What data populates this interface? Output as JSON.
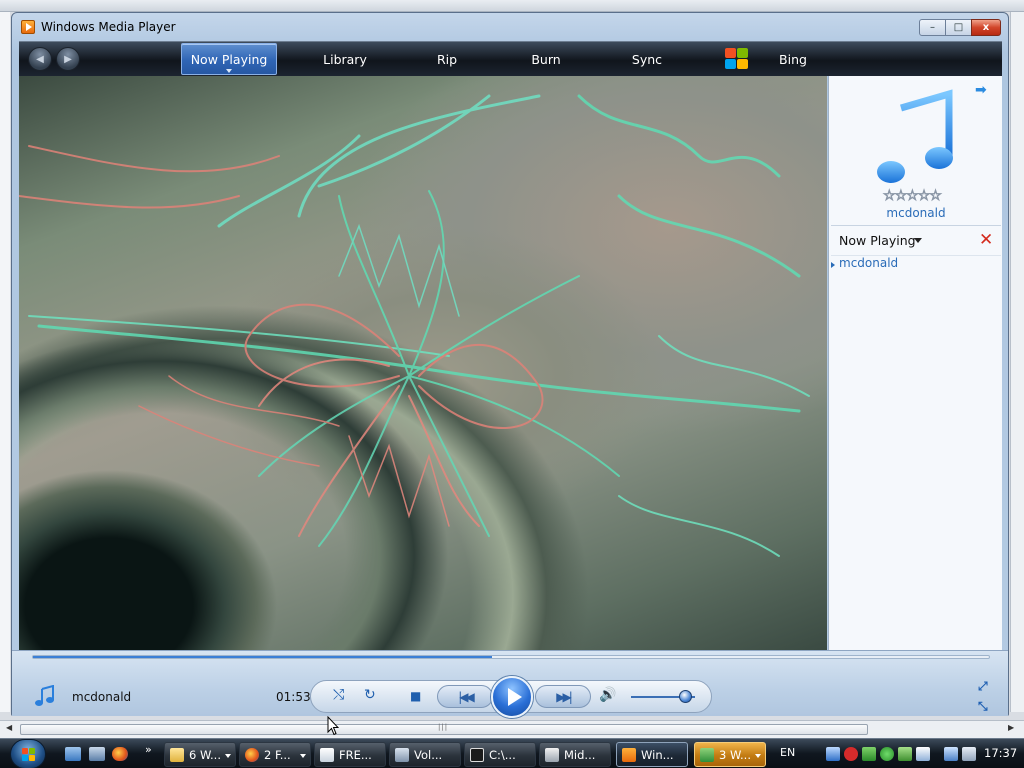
{
  "window": {
    "title": "Windows Media Player",
    "controls": {
      "minimize": "–",
      "maximize": "□",
      "close": "x"
    }
  },
  "nav": {
    "back_glyph": "◀",
    "forward_glyph": "▶",
    "tabs": [
      {
        "label": "Now Playing",
        "active": true
      },
      {
        "label": "Library"
      },
      {
        "label": "Rip"
      },
      {
        "label": "Burn"
      },
      {
        "label": "Sync"
      },
      {
        "label": "Bing"
      }
    ]
  },
  "panel": {
    "album_title": "mcdonald",
    "rating": {
      "filled": 0,
      "max": 5
    },
    "stars": [
      "☆",
      "☆",
      "☆",
      "☆",
      "☆"
    ],
    "arrow_glyph": "➡",
    "now_playing_label": "Now Playing",
    "clear_glyph": "✕",
    "playlist": [
      "mcdonald"
    ]
  },
  "player": {
    "song_title": "mcdonald",
    "elapsed": "01:53",
    "seek_progress": 0.48,
    "volume": 0.85,
    "shuffle_glyph": "⤭",
    "repeat_glyph": "↻",
    "stop_glyph": "■",
    "prev_glyph": "|◀◀",
    "next_glyph": "▶▶|",
    "volume_glyph": "🔊",
    "fullscreen_glyph": "⤢",
    "compact_glyph": "⤡"
  },
  "taskbar": {
    "quick_more": "»",
    "tasks": [
      {
        "label": "6 W...",
        "active": false,
        "grouped": true
      },
      {
        "label": "2 F...",
        "active": false,
        "grouped": true
      },
      {
        "label": "FRE...",
        "active": false
      },
      {
        "label": "Vol...",
        "active": false
      },
      {
        "label": "C:\\...",
        "active": false
      },
      {
        "label": "Mid...",
        "active": false
      },
      {
        "label": "Win...",
        "active": true
      },
      {
        "label": "3 W...",
        "active": false,
        "grouped": true,
        "flash": true
      }
    ],
    "language": "EN",
    "clock": "17:37"
  },
  "colors": {
    "accent": "#2a6cb8",
    "nav_bar": "#10151c",
    "active_tab": "#2f65b5",
    "close_button": "#d1452a",
    "visualizer_green": "#5fdcb4",
    "visualizer_red": "#e08278"
  }
}
